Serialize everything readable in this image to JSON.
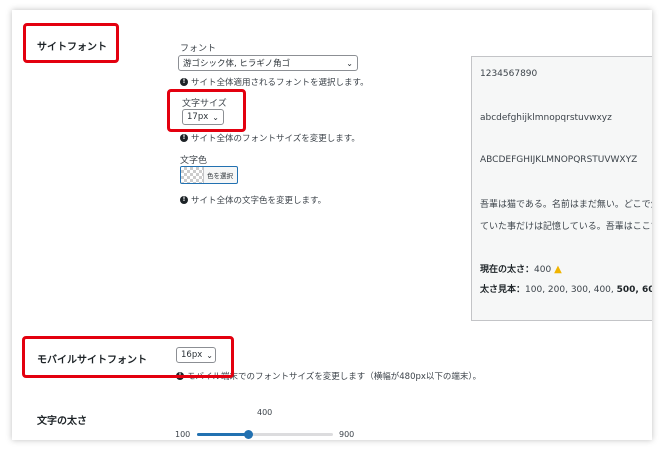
{
  "site_font": {
    "section_label": "サイトフォント",
    "font_label": "フォント",
    "font_select_value": "游ゴシック体, ヒラギノ角ゴ",
    "font_desc": "サイト全体適用されるフォントを選択します。",
    "size_label": "文字サイズ",
    "size_select_value": "17px",
    "size_desc": "サイト全体のフォントサイズを変更します。",
    "color_label": "文字色",
    "color_button_label": "色を選択",
    "color_desc": "サイト全体の文字色を変更します。"
  },
  "preview": {
    "numbers": "1234567890",
    "lowercase": "abcdefghijklmnopqrstuvwxyz",
    "uppercase": "ABCDEFGHIJKLMNOPQRSTUVWXYZ",
    "sample_line1": "吾輩は猫である。名前はまだ無い。どこで生れたかとんと見当がつかぬ。",
    "sample_line2": "ていた事だけは記憶している。吾輩はここで始めて人間というものを見た。",
    "current_weight_label": "現在の太さ：",
    "current_weight_value": "400",
    "weight_samples_label": "太さ見本：",
    "weight_samples_normal": "100, 200, 300, 400, ",
    "weight_samples_bold": "500, 600"
  },
  "mobile_font": {
    "section_label": "モバイルサイトフォント",
    "size_select_value": "16px",
    "desc": "モバイル端末でのフォントサイズを変更します（横幅が480px以下の端末）。"
  },
  "font_weight": {
    "section_label": "文字の太さ",
    "current_value": "400",
    "min_label": "100",
    "max_label": "900",
    "slider_fraction": 0.375
  },
  "colors": {
    "highlight": "#e3000f",
    "accent": "#2271b1",
    "warning": "#f0b400"
  }
}
